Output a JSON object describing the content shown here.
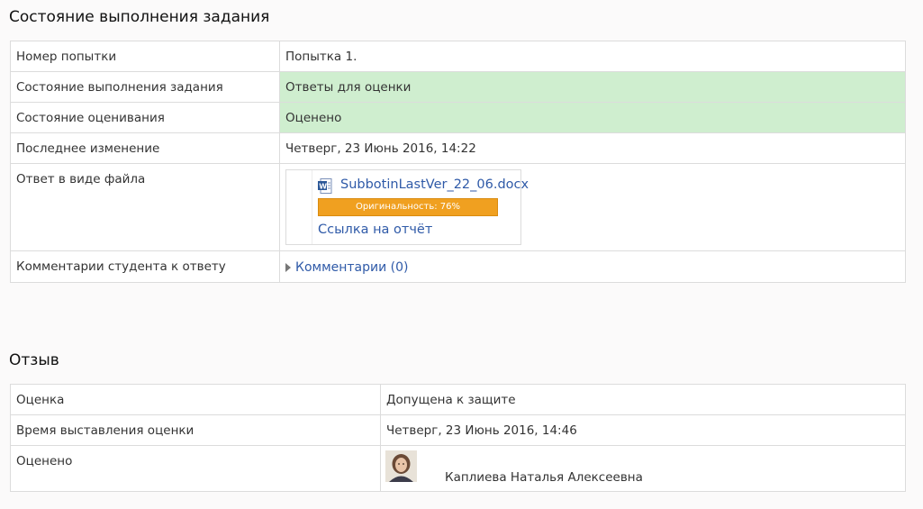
{
  "submission_status": {
    "heading": "Состояние выполнения задания",
    "rows": {
      "attempt_label": "Номер попытки",
      "attempt_value": "Попытка 1.",
      "submission_label": "Состояние выполнения задания",
      "submission_value": "Ответы для оценки",
      "grading_label": "Состояние оценивания",
      "grading_value": "Оценено",
      "modified_label": "Последнее изменение",
      "modified_value": "Четверг, 23 Июнь 2016, 14:22",
      "file_label": "Ответ в виде файла",
      "file_name": "SubbotinLastVer_22_06.docx",
      "originality_text": "Оригинальность: 76%",
      "originality_percent": 76,
      "report_link": "Ссылка на отчёт",
      "comments_label": "Комментарии студента к ответу",
      "comments_link": "Комментарии (0)"
    }
  },
  "feedback": {
    "heading": "Отзыв",
    "rows": {
      "grade_label": "Оценка",
      "grade_value": "Допущена к защите",
      "graded_time_label": "Время выставления оценки",
      "graded_time_value": "Четверг, 23 Июнь 2016, 14:46",
      "graded_by_label": "Оценено",
      "grader_name": "Каплиева Наталья Алексеевна"
    }
  },
  "colors": {
    "status_ok_bg": "#cfeecf",
    "link": "#2f5aa8",
    "originality_bar": "#f0a020"
  },
  "icons": [
    "word-document-icon",
    "expand-triangle-icon",
    "grader-avatar"
  ]
}
